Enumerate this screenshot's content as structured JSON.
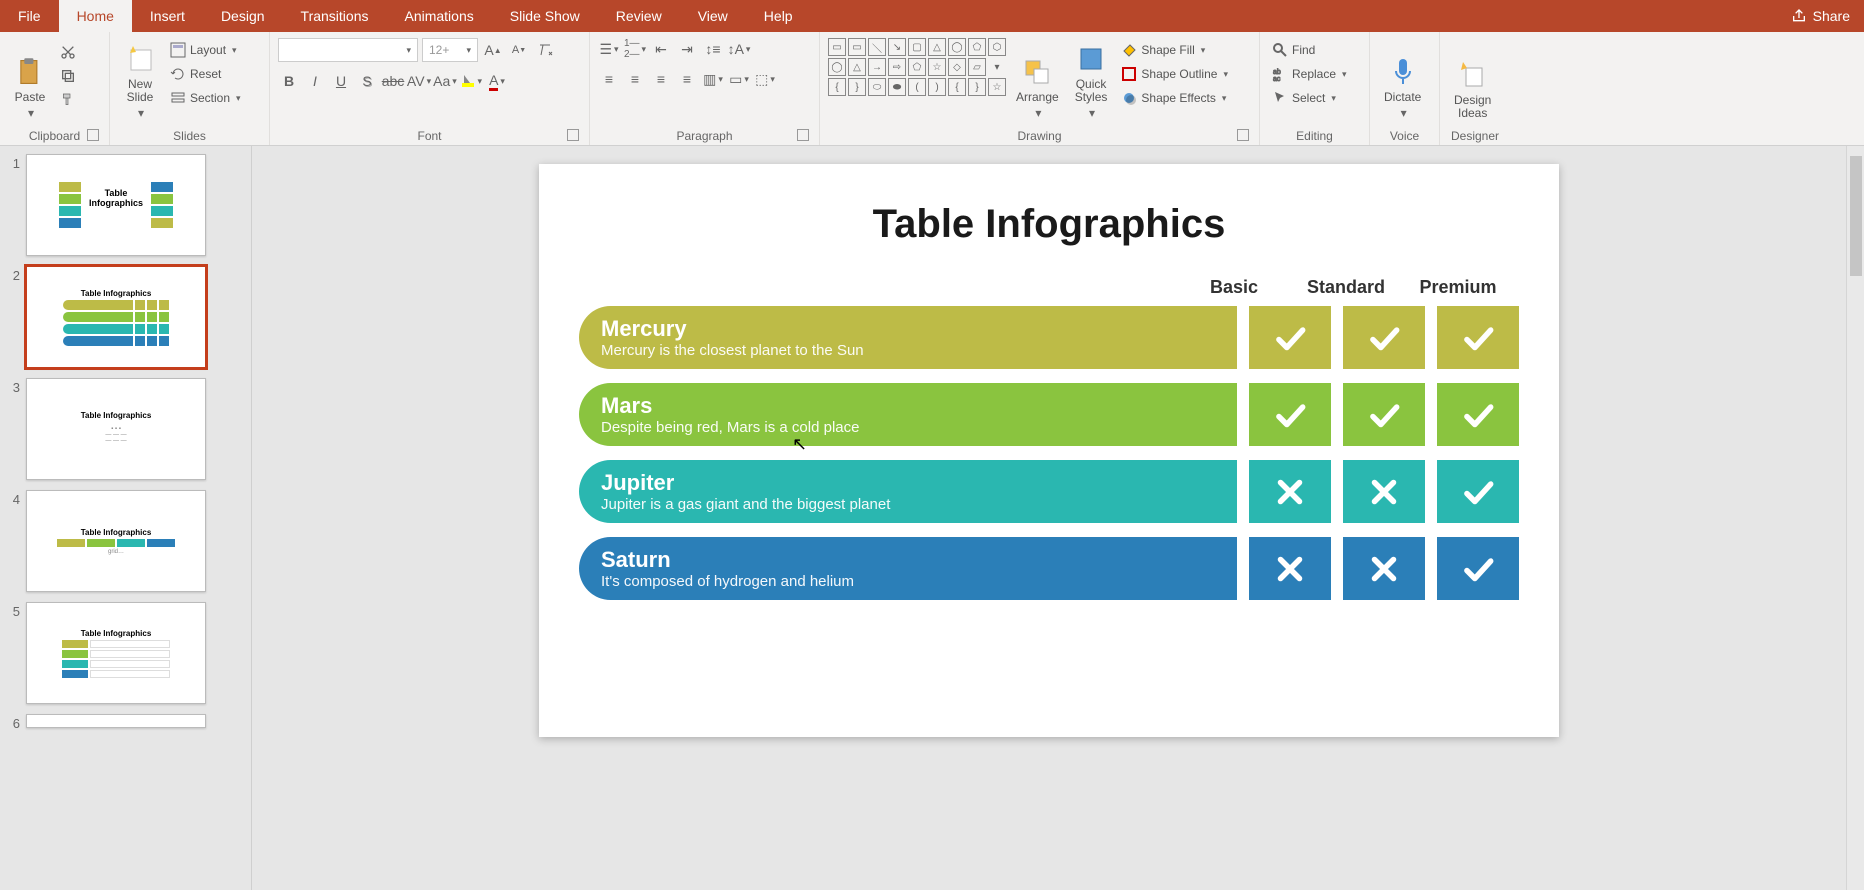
{
  "tabs": [
    "File",
    "Home",
    "Insert",
    "Design",
    "Transitions",
    "Animations",
    "Slide Show",
    "Review",
    "View",
    "Help"
  ],
  "active_tab": 1,
  "share": "Share",
  "ribbon": {
    "clipboard": {
      "paste": "Paste",
      "label": "Clipboard"
    },
    "slides": {
      "new_slide": "New\nSlide",
      "layout": "Layout",
      "reset": "Reset",
      "section": "Section",
      "label": "Slides"
    },
    "font": {
      "size": "12+",
      "label": "Font"
    },
    "paragraph": {
      "label": "Paragraph"
    },
    "drawing": {
      "arrange": "Arrange",
      "quick": "Quick\nStyles",
      "fill": "Shape Fill",
      "outline": "Shape Outline",
      "effects": "Shape Effects",
      "label": "Drawing"
    },
    "editing": {
      "find": "Find",
      "replace": "Replace",
      "select": "Select",
      "label": "Editing"
    },
    "voice": {
      "dictate": "Dictate",
      "label": "Voice"
    },
    "designer": {
      "ideas": "Design\nIdeas",
      "label": "Designer"
    }
  },
  "thumbs_title": "Table Infographics",
  "slide": {
    "title": "Table Infographics",
    "plans": [
      "Basic",
      "Standard",
      "Premium"
    ],
    "rows": [
      {
        "name": "Mercury",
        "desc": "Mercury is the closest planet to the Sun",
        "color": "c-olive",
        "marks": [
          "check",
          "check",
          "check"
        ]
      },
      {
        "name": "Mars",
        "desc": "Despite being red, Mars is a cold place",
        "color": "c-green",
        "marks": [
          "check",
          "check",
          "check"
        ]
      },
      {
        "name": "Jupiter",
        "desc": "Jupiter is a gas giant and the biggest planet",
        "color": "c-teal",
        "marks": [
          "cross",
          "cross",
          "check"
        ]
      },
      {
        "name": "Saturn",
        "desc": "It's composed of hydrogen and helium",
        "color": "c-blue",
        "marks": [
          "cross",
          "cross",
          "check"
        ]
      }
    ]
  }
}
